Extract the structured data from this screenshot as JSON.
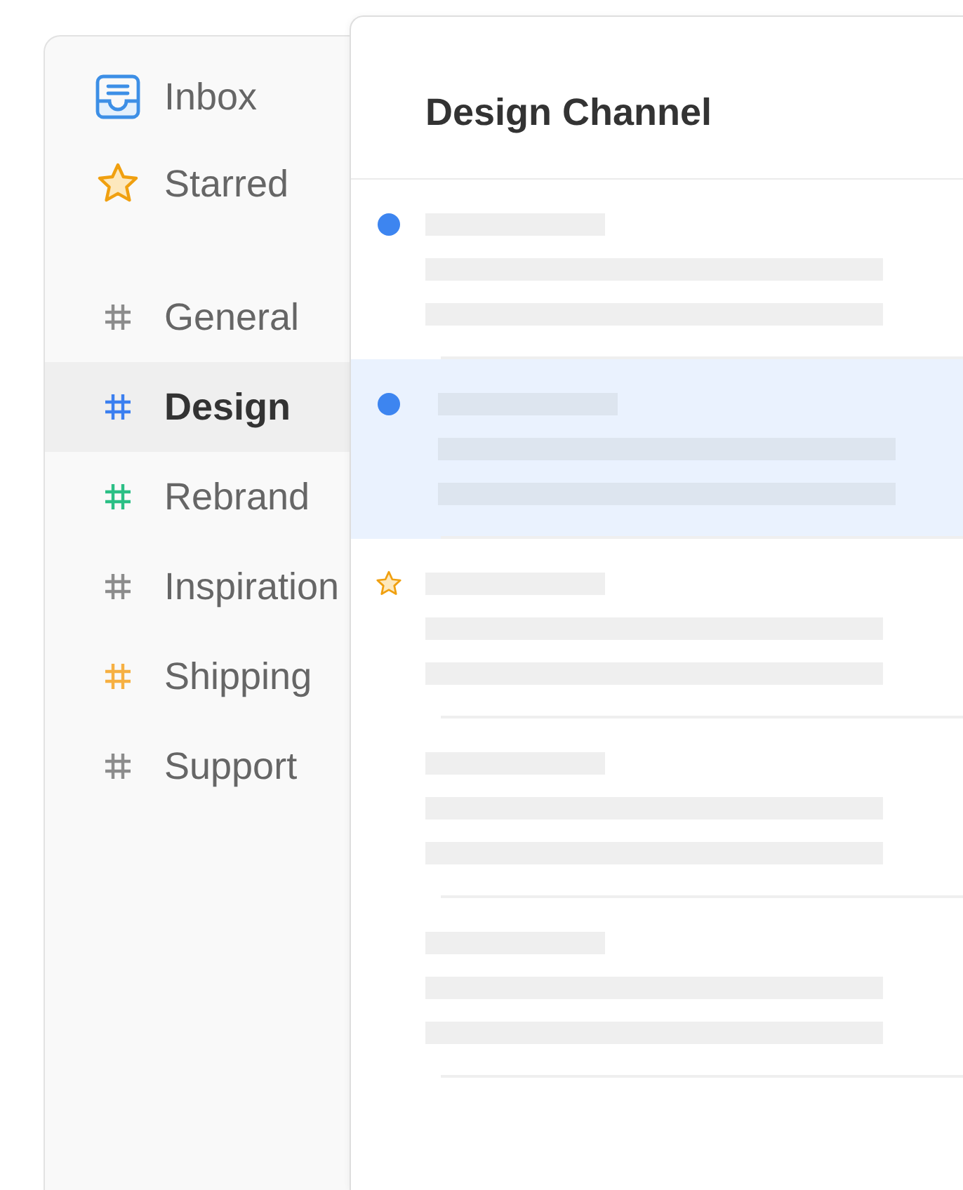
{
  "sidebar": {
    "items": [
      {
        "kind": "inbox",
        "label": "Inbox",
        "selected": false
      },
      {
        "kind": "starred",
        "label": "Starred",
        "selected": false
      }
    ],
    "channels": [
      {
        "label": "General",
        "color": "#8c8c8c",
        "selected": false
      },
      {
        "label": "Design",
        "color": "#3b7ff0",
        "selected": true
      },
      {
        "label": "Rebrand",
        "color": "#2bbf85",
        "selected": false
      },
      {
        "label": "Inspiration",
        "color": "#8c8c8c",
        "selected": false
      },
      {
        "label": "Shipping",
        "color": "#f6b042",
        "selected": false
      },
      {
        "label": "Support",
        "color": "#8c8c8c",
        "selected": false
      }
    ]
  },
  "channel": {
    "title": "Design Channel",
    "messages": [
      {
        "selected": false,
        "unread": true,
        "starred": false
      },
      {
        "selected": true,
        "unread": true,
        "starred": false
      },
      {
        "selected": false,
        "unread": false,
        "starred": true
      },
      {
        "selected": false,
        "unread": false,
        "starred": false
      },
      {
        "selected": false,
        "unread": false,
        "starred": false
      }
    ]
  }
}
